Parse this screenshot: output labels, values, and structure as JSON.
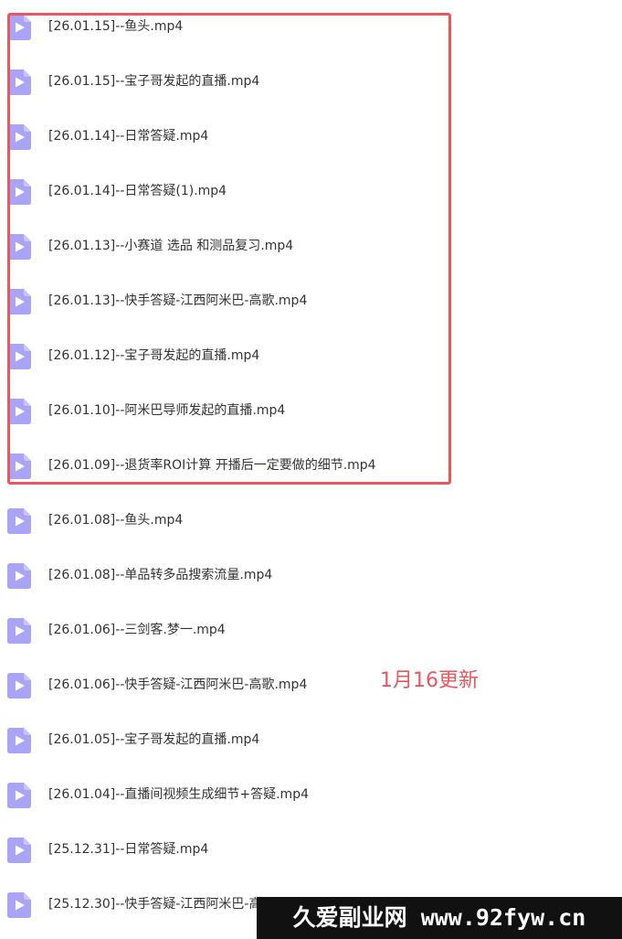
{
  "files": [
    {
      "name": "[26.01.15]--鱼头.mp4"
    },
    {
      "name": "[26.01.15]--宝子哥发起的直播.mp4"
    },
    {
      "name": "[26.01.14]--日常答疑.mp4"
    },
    {
      "name": "[26.01.14]--日常答疑(1).mp4"
    },
    {
      "name": "[26.01.13]--小赛道 选品 和测品复习.mp4"
    },
    {
      "name": "[26.01.13]--快手答疑-江西阿米巴-高歌.mp4"
    },
    {
      "name": "[26.01.12]--宝子哥发起的直播.mp4"
    },
    {
      "name": "[26.01.10]--阿米巴导师发起的直播.mp4"
    },
    {
      "name": "[26.01.09]--退货率ROI计算 开播后一定要做的细节.mp4"
    },
    {
      "name": "[26.01.08]--鱼头.mp4"
    },
    {
      "name": "[26.01.08]--单品转多品搜索流量.mp4"
    },
    {
      "name": "[26.01.06]--三剑客.梦一.mp4"
    },
    {
      "name": "[26.01.06]--快手答疑-江西阿米巴-高歌.mp4"
    },
    {
      "name": "[26.01.05]--宝子哥发起的直播.mp4"
    },
    {
      "name": "[26.01.04]--直播间视频生成细节+答疑.mp4"
    },
    {
      "name": "[25.12.31]--日常答疑.mp4"
    },
    {
      "name": "[25.12.30]--快手答疑-江西阿米巴-高歌.mp4"
    }
  ],
  "annotation": "1月16更新",
  "watermark": "久爱副业网 www.92fyw.cn",
  "colors": {
    "highlight": "#e8575d",
    "icon": "#a9a4f5",
    "text": "#333333"
  },
  "icon": "video-file-icon"
}
